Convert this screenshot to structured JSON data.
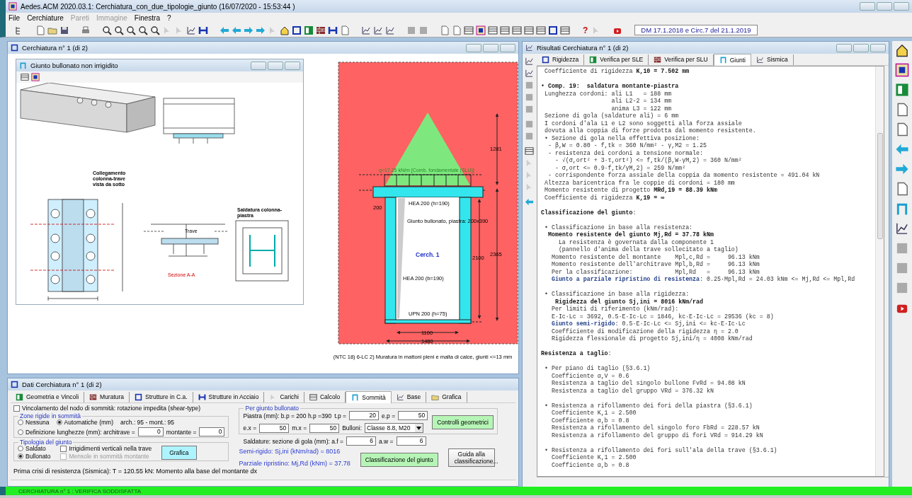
{
  "window": {
    "title": "Aedes.ACM 2020.03.1: Cerchiatura_con_due_tipologie_giunto  (16/07/2020 - 15:53:44 )"
  },
  "menu": [
    {
      "label": "File",
      "disabled": false
    },
    {
      "label": "Cerchiature",
      "disabled": false
    },
    {
      "label": "Pareti",
      "disabled": true
    },
    {
      "label": "Immagine",
      "disabled": true
    },
    {
      "label": "Finestra",
      "disabled": false
    },
    {
      "label": "?",
      "disabled": false
    }
  ],
  "toolbar": {
    "help_label": "?",
    "norm_label": "DM 17.1.2018 e Circ.7 del 21.1.2019"
  },
  "graph_window": {
    "title": "Cerchiatura n° 1 (di 2)",
    "joint_window": {
      "title": "Giunto bullonato non irrigidito",
      "labels": [
        {
          "kind": "connection",
          "text": "Collegamento colonna-trave vista da sotto"
        },
        {
          "kind": "weld",
          "text": "Saldatura colonna-piastra"
        },
        {
          "kind": "beam",
          "text": "Trave"
        },
        {
          "kind": "section",
          "text": "Sezione A-A"
        }
      ]
    },
    "frame": {
      "labels": [
        {
          "kind": "load",
          "text": "q=17.25 kN/m [Comb. fondamentale (SLU)]"
        },
        {
          "kind": "dimtop",
          "text": "1281"
        },
        {
          "kind": "dimplate",
          "text": "200"
        },
        {
          "kind": "beam",
          "text": "HEA 200 (h=190)"
        },
        {
          "kind": "joint",
          "text": "Giunto bullonato, piastra: 200x390"
        },
        {
          "kind": "name",
          "text": "Cerch. 1"
        },
        {
          "kind": "dimclear",
          "text": "2100"
        },
        {
          "kind": "dimtotal",
          "text": "2365"
        },
        {
          "kind": "column",
          "text": "HEA 200 (b=190)"
        },
        {
          "kind": "sill",
          "text": "UPN 200 (h=75)"
        },
        {
          "kind": "widthclear",
          "text": "1100"
        },
        {
          "kind": "widthtotal",
          "text": "1480"
        }
      ],
      "caption": "(NTC 18) 6-LC 2) Muratura in mattoni pieni e malta di calce, giunti <=13 mm"
    }
  },
  "data_window": {
    "title": "Dati Cerchiatura n° 1 (di 2)",
    "tabs": [
      {
        "label": "Geometria e Vincoli",
        "selected": false
      },
      {
        "label": "Muratura",
        "selected": false
      },
      {
        "label": "Strutture in C.a.",
        "selected": false
      },
      {
        "label": "Strutture in Acciaio",
        "selected": false
      },
      {
        "label": "Carichi",
        "selected": false
      },
      {
        "label": "Calcolo",
        "selected": false
      },
      {
        "label": "Sommità",
        "selected": true
      },
      {
        "label": "Base",
        "selected": false
      },
      {
        "label": "Grafica",
        "selected": false
      }
    ],
    "restraint": {
      "label": "Vincolamento del nodo di sommità: rotazione impedita (shear-type)",
      "checked": false
    },
    "rigid_zones": {
      "legend": "Zone rigide in sommità",
      "options": [
        {
          "label": "Nessuna",
          "selected": false
        },
        {
          "label": "Automatiche (mm)",
          "selected": true
        },
        {
          "label": "Definizione lunghezze (mm): architrave =",
          "selected": false
        }
      ],
      "auto_info": "arch.: 95 - mont.: 95",
      "architrave": {
        "value": "0"
      },
      "montante": {
        "label": "montante =",
        "value": "0"
      }
    },
    "joint_type": {
      "legend": "Tipologia del giunto",
      "options": [
        {
          "label": "Saldato",
          "selected": false
        },
        {
          "label": "Bullonato",
          "selected": true
        }
      ],
      "checks": [
        {
          "label": "Irrigidimenti verticali nella trave",
          "checked": false,
          "disabled": false
        },
        {
          "label": "Mensole in sommità montante",
          "checked": false,
          "disabled": true
        }
      ],
      "button": "Grafica"
    },
    "bolted": {
      "legend": "Per giunto bullonato",
      "plate_info": "Piastra (mm): b.p = 200  h.p =390",
      "row_1": [
        {
          "label": "t.p =",
          "value": "20"
        },
        {
          "label": "e.p =",
          "value": "50"
        }
      ],
      "row_2": [
        {
          "label": "e.x =",
          "value": "50"
        },
        {
          "label": "m.x =",
          "value": "50"
        }
      ],
      "bolts": {
        "label": "Bulloni:",
        "value": "Classe 8.8, M20"
      },
      "button": "Controlli geometrici"
    },
    "welds": {
      "label": "Saldature: sezione di gola (mm): a.f =",
      "af": "6",
      "aw_label": "a.w =",
      "aw": "6"
    },
    "results": [
      "Semi-rigido: Sj,ini (kNm/rad) = 8016",
      "Parziale ripristino: Mj,Rd (kNm) = 37.78"
    ],
    "buttons": [
      {
        "label": "Classificazione del giunto",
        "kind": "primary"
      },
      {
        "label": "Guida alla classificazione...",
        "kind": "plain"
      }
    ],
    "message": "Prima crisi di resistenza (Sismica): T = 120.55 kN: Momento alla base del montante dx"
  },
  "results_window": {
    "title": "Risultati Cerchiatura n° 1 (di 2)",
    "tabs": [
      {
        "label": "Rigidezza",
        "selected": false
      },
      {
        "label": "Verifica per SLE",
        "selected": false
      },
      {
        "label": "Verifica per SLU",
        "selected": false
      },
      {
        "label": "Giunti",
        "selected": true
      },
      {
        "label": "Sismica",
        "selected": false
      }
    ],
    "blocks": [
      {
        "lines": [
          " Coefficiente di rigidezza **K,10 = 7.502 mm**"
        ]
      },
      {
        "lines": [
          "**• Comp. 19:  saldatura montante-piastra**",
          " Lunghezza cordoni: ali L1   = 188 mm",
          "                    ali L2-2 = 134 mm",
          "                    anima L3 = 122 mm",
          " Sezione di gola (saldature ali) = 6 mm",
          " I cordoni d'ala L1 e L2 sono soggetti alla forza assiale",
          " dovuta alla coppia di forze prodotta dal momento resistente.",
          " • Sezione di gola nella effettiva posizione:",
          "  - β,W = 0.80 - f,tk = 360 N/mm² - γ,M2 = 1.25",
          "  - resistenza dei cordoni a tensione normale:",
          "    - √(σ,ort² + 3·τ,ort²) <= f,tk/(β,W·γM,2) = 360 N/mm²",
          "    - σ,ort <= 0.9·f,tk/γM,2) = 259 N/mm²",
          "  - corrispondente forza assiale della coppia da momento resistente = 491.04 kN",
          " Altezza baricentrica fra le coppie di cordoni = 180 mm",
          " Momento resistente di progetto **MRd,19 = 88.39 kNm**",
          " Coefficiente di rigidezza **K,19 = ∞**"
        ]
      },
      {
        "lines": [
          "**Classificazione del giunto**:"
        ]
      },
      {
        "lines": [
          " • Classificazione in base alla resistenza:",
          "  **Momento resistente del giunto Mj,Rd = 37.78 kNm**",
          "     La resistenza è governata dalla componente 1",
          "     (pannello d'anima della trave sollecitato a taglio)",
          "   Momento resistente del montante    Mpl,c,Rd =     96.13 kNm",
          "   Momento resistente dell'architrave Mpl,b,Rd =     96.13 kNm",
          "   Per la classificazione:            Mpl,Rd   =     96.13 kNm",
          {
            "lead": "   Giunto a parziale ripristino di resistenza",
            "text": ": 0.25·Mpl,Rd = 24.03 kNm <= Mj,Rd <= Mpl,Rd"
          }
        ]
      },
      {
        "lines": [
          " • Classificazione in base alla rigidezza:",
          "    **Rigidezza del giunto Sj,ini = 8016 kNm/rad**",
          "   Per limiti di riferimento (kNm/rad):",
          "   E·Ic·Lc = 3692, 0.5·E·Ic·Lc = 1846, kc·E·Ic·Lc = 29536 (kc = 8)",
          {
            "lead": "   Giunto semi-rigido",
            "text": ": 0.5·E·Ic·Lc <= Sj,ini <= kc·E·Ic·Lc"
          },
          "   Coefficiente di modificazione della rigidezza η = 2.0",
          "   Rigidezza flessionale di progetto Sj,ini/η = 4008 kNm/rad"
        ]
      },
      {
        "lines": [
          "**Resistenza a taglio**:"
        ]
      },
      {
        "lines": [
          " • Per piano di taglio (§3.6.1)",
          "   Coefficiente α,V = 0.6",
          "   Resistenza a taglio del singolo bullone FvRd = 94.08 kN",
          "   Resistenza a taglio del gruppo VRd = 376.32 kN"
        ]
      },
      {
        "lines": [
          " • Resistenza a rifollamento dei fori della piastra (§3.6.1)",
          "   Coefficiente K,1 = 2.500",
          "   Coefficiente α,b = 0.8",
          "   Resistenza a rifollamento del singolo foro FbRd = 228.57 kN",
          "   Resistenza a rifollamento del gruppo di fori VRd = 914.29 kN"
        ]
      },
      {
        "lines": [
          " • Resistenza a rifollamento dei fori sull'ala della trave (§3.6.1)",
          "   Coefficiente K,1 = 2.500",
          "   Coefficiente α,b = 0.8"
        ]
      }
    ]
  },
  "status_bar": {
    "text": "CERCHIATURA n° 1 : VERIFICA SODDISFATTA"
  }
}
